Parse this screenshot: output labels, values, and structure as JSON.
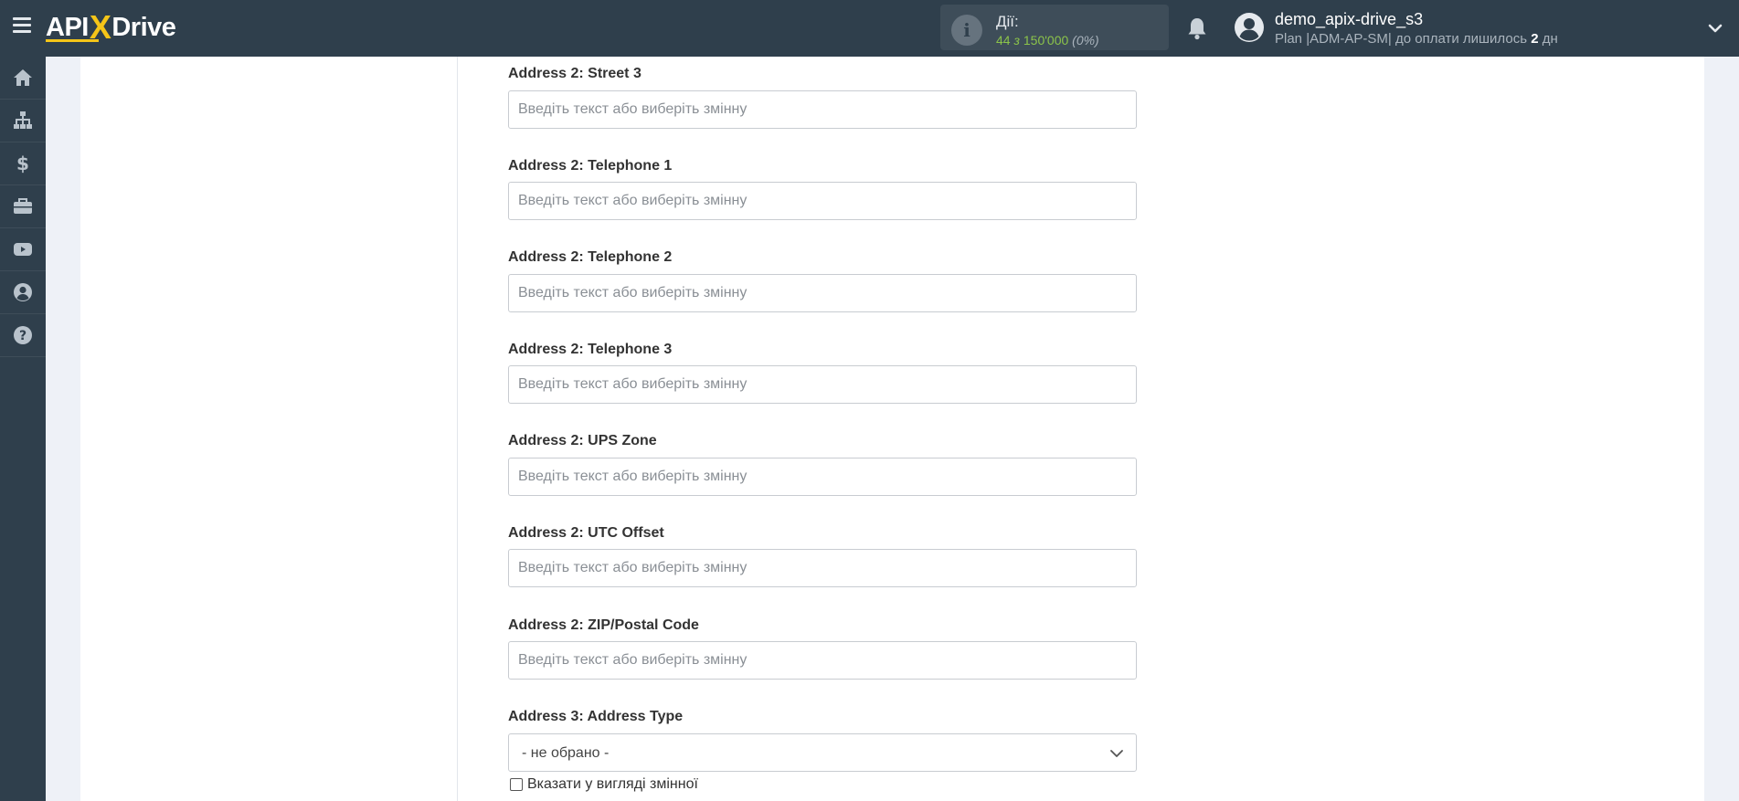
{
  "header": {
    "logo": {
      "part1": "API",
      "part2": "X",
      "part3": "Drive"
    },
    "actions": {
      "label": "Дії:",
      "used": "44",
      "of": "з",
      "total": "150'000",
      "percent": "(0%)"
    },
    "user": {
      "name": "demo_apix-drive_s3",
      "plan_prefix": "Plan |ADM-AP-SM| до оплати лишилось ",
      "days": "2",
      "days_suffix": " дн"
    }
  },
  "sidebar": {
    "items": [
      {
        "icon": "home-icon"
      },
      {
        "icon": "sitemap-icon"
      },
      {
        "icon": "dollar-icon"
      },
      {
        "icon": "briefcase-icon"
      },
      {
        "icon": "youtube-icon"
      },
      {
        "icon": "user-circle-icon"
      },
      {
        "icon": "question-circle-icon"
      }
    ]
  },
  "form": {
    "placeholder": "Введіть текст або виберіть змінну",
    "fields": [
      {
        "label": "Address 2: Street 3",
        "value": ""
      },
      {
        "label": "Address 2: Telephone 1",
        "value": ""
      },
      {
        "label": "Address 2: Telephone 2",
        "value": ""
      },
      {
        "label": "Address 2: Telephone 3",
        "value": ""
      },
      {
        "label": "Address 2: UPS Zone",
        "value": ""
      },
      {
        "label": "Address 2: UTC Offset",
        "value": ""
      },
      {
        "label": "Address 2: ZIP/Postal Code",
        "value": ""
      }
    ],
    "select": {
      "label": "Address 3: Address Type",
      "value": "- не обрано -"
    },
    "checkbox": {
      "label": "Вказати у вигляді змінної",
      "checked": false
    }
  },
  "colors": {
    "header_bg": "#2f3f4c",
    "accent_yellow": "#f5c518",
    "actions_green": "#8bc34a"
  }
}
